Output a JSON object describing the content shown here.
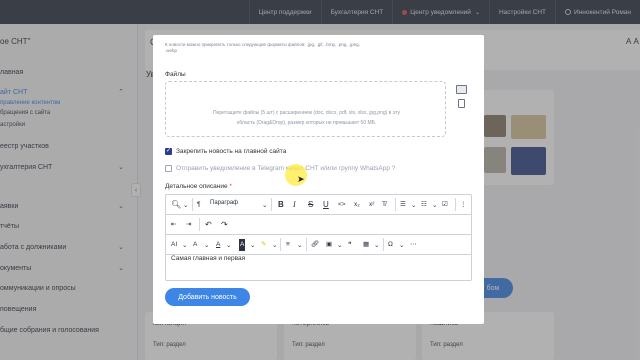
{
  "topbar": {
    "support": "Центр поддержки",
    "accounting": "Бухгалтерия СНТ",
    "notifications": "Центр уведомлений",
    "settings": "Настройки СНТ",
    "user": "Иннокентий Роман"
  },
  "sidebar": {
    "brand": "ое СНТ\"",
    "items": [
      {
        "label": "лавная"
      },
      {
        "label": "айт СНТ"
      },
      {
        "label": "правление контентом"
      },
      {
        "label": "бращения с сайта"
      },
      {
        "label": "астройки"
      },
      {
        "label": "еестр участков"
      },
      {
        "label": "ухгалтерия СНТ"
      },
      {
        "label": "аявки"
      },
      {
        "label": "тчёты"
      },
      {
        "label": "абота с должниками"
      },
      {
        "label": "окументы"
      },
      {
        "label": "оммуникации и опросы"
      },
      {
        "label": "повещения"
      },
      {
        "label": "бщие собрания и голосования"
      }
    ]
  },
  "page": {
    "heading": "С",
    "aa": "А  А",
    "section": "Ув"
  },
  "bg_cards": [
    {
      "title": "квитанция",
      "sub": "Тип: раздел"
    },
    {
      "title": "потерялись",
      "sub": "Тип: раздел"
    },
    {
      "title": "нашлись",
      "sub": "Тип: раздел"
    }
  ],
  "right_button": "бом",
  "modal": {
    "top_note": "К новости можно прикрепить только следующие форматы файлов: .jpg, .gif, .bmp, .png, .jpeg, .webp",
    "files_label": "Файлы",
    "dropzone_line1": "Перетащите файлы (5 шт) с расширением (doc, docx, pdf, xls, xlsx, jpg,png) в эту",
    "dropzone_line2": "область (Drag&Drop), размер которых не превышает 50 МБ.",
    "pin_label": "Закрепить новость на главной сайта",
    "telegram_label": "Отправить уведомление в Telegram канал СНТ и/или группу WhatsApp",
    "telegram_q": "?",
    "desc_label": "Детальное описание",
    "desc_req": "*",
    "paragraph": "Параграф",
    "editor_text": "Самая главная и первая",
    "add_button": "Добавить новость"
  },
  "colors": {
    "topbar": "#323a48",
    "accent": "#3d86e6",
    "checkbox": "#2d3c8e",
    "required": "#e23c3c"
  }
}
